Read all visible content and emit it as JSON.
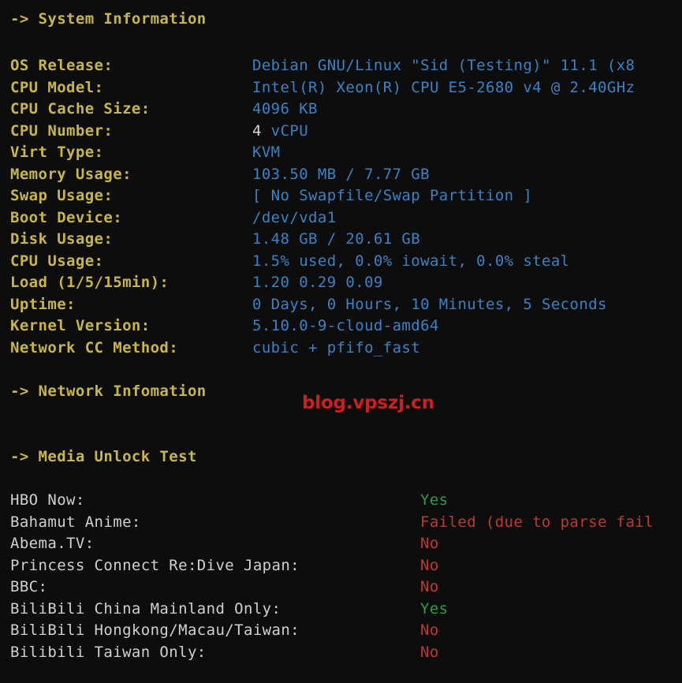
{
  "terminal": {
    "background_color": "#0d0d0d",
    "label_color": "#c8b64a",
    "value_color": "#3b82c4",
    "plain_color": "#d8d8d8",
    "media_label_color": "#d0d0d0",
    "yes_color": "#2f9e44",
    "no_color": "#c0392f",
    "watermark_color": "#cc1f1f"
  },
  "sections": {
    "system_information": {
      "header": "-> System Information",
      "rows": [
        {
          "label": "OS Release:",
          "value": "Debian GNU/Linux \"Sid (Testing)\" 11.1 (x8"
        },
        {
          "label": "CPU Model:",
          "value": "Intel(R) Xeon(R) CPU E5-2680 v4 @ 2.40GHz"
        },
        {
          "label": "CPU Cache Size:",
          "value": "4096 KB"
        },
        {
          "label": "CPU Number:",
          "value": "4 vCPU",
          "plain_prefix": "4",
          "rest": " vCPU"
        },
        {
          "label": "Virt Type:",
          "value": "KVM"
        },
        {
          "label": "Memory Usage:",
          "value": "103.50 MB / 7.77 GB"
        },
        {
          "label": "Swap Usage:",
          "value": "[ No Swapfile/Swap Partition ]"
        },
        {
          "label": "Boot Device:",
          "value": "/dev/vda1"
        },
        {
          "label": "Disk Usage:",
          "value": "1.48 GB / 20.61 GB"
        },
        {
          "label": "CPU Usage:",
          "value": "1.5% used, 0.0% iowait, 0.0% steal"
        },
        {
          "label": "Load (1/5/15min):",
          "value": "1.20 0.29 0.09"
        },
        {
          "label": "Uptime:",
          "value": "0 Days, 0 Hours, 10 Minutes, 5 Seconds"
        },
        {
          "label": "Kernel Version:",
          "value": "5.10.0-9-cloud-amd64"
        },
        {
          "label": "Network CC Method:",
          "value": "cubic + pfifo_fast"
        }
      ]
    },
    "network_information": {
      "header": "-> Network Infomation"
    },
    "media_unlock_test": {
      "header": "-> Media Unlock Test",
      "rows": [
        {
          "label": "HBO Now:",
          "value": "Yes",
          "status": "yes"
        },
        {
          "label": "Bahamut Anime:",
          "value": "Failed (due to parse fail",
          "status": "failed"
        },
        {
          "label": "Abema.TV:",
          "value": "No",
          "status": "no"
        },
        {
          "label": "Princess Connect Re:Dive Japan:",
          "value": "No",
          "status": "no"
        },
        {
          "label": "BBC:",
          "value": "No",
          "status": "no"
        },
        {
          "label": "BiliBili China Mainland Only:",
          "value": "Yes",
          "status": "yes"
        },
        {
          "label": "BiliBili Hongkong/Macau/Taiwan:",
          "value": "No",
          "status": "no"
        },
        {
          "label": "Bilibili Taiwan Only:",
          "value": "No",
          "status": "no"
        }
      ]
    }
  },
  "watermark": {
    "text": "blog.vpszj.cn"
  }
}
